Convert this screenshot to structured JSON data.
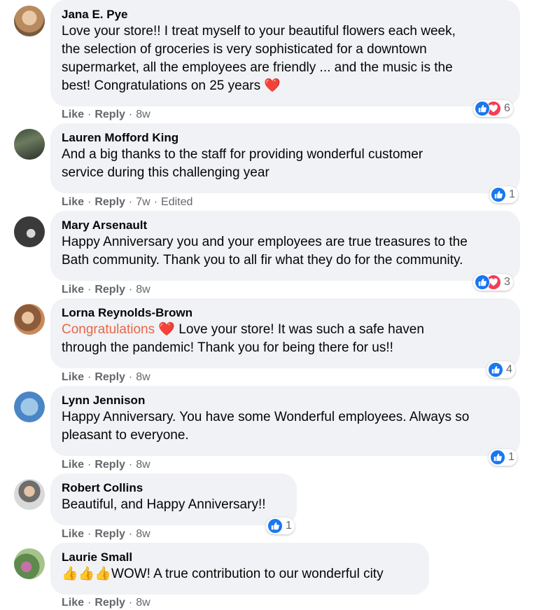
{
  "comments": [
    {
      "name": "Jana E. Pye",
      "lines": [
        "Love your store!! I treat myself to your beautiful flowers each week,",
        "the selection of groceries is very sophisticated for a downtown",
        "supermarket, all the employees are friendly ... and the music is the",
        "best! Congratulations on 25 years ❤️"
      ],
      "like": "Like",
      "reply": "Reply",
      "time": "8w",
      "edited": "",
      "reaction_count": "6",
      "reactions": [
        "like-icon",
        "love-icon"
      ]
    },
    {
      "name": "Lauren Mofford King",
      "lines": [
        "And a big thanks to the staff for providing wonderful customer",
        "service during this challenging year"
      ],
      "like": "Like",
      "reply": "Reply",
      "time": "7w",
      "edited": "Edited",
      "reaction_count": "1",
      "reactions": [
        "like-icon"
      ]
    },
    {
      "name": "Mary Arsenault",
      "lines": [
        "Happy Anniversary you and your employees are true treasures to the",
        "Bath community. Thank you to all fir what they do for the community."
      ],
      "like": "Like",
      "reply": "Reply",
      "time": "8w",
      "edited": "",
      "reaction_count": "3",
      "reactions": [
        "like-icon",
        "love-icon"
      ]
    },
    {
      "name": "Lorna Reynolds-Brown",
      "highlight": "Congratulations",
      "lines": [
        " ❤️ Love your store! It was such a safe haven",
        "through the pandemic! Thank you for being there for us!!"
      ],
      "like": "Like",
      "reply": "Reply",
      "time": "8w",
      "edited": "",
      "reaction_count": "4",
      "reactions": [
        "like-icon"
      ]
    },
    {
      "name": "Lynn Jennison",
      "lines": [
        "Happy Anniversary. You have some Wonderful employees. Always so",
        "pleasant to everyone."
      ],
      "like": "Like",
      "reply": "Reply",
      "time": "8w",
      "edited": "",
      "reaction_count": "1",
      "reactions": [
        "like-icon"
      ]
    },
    {
      "name": "Robert Collins",
      "lines": [
        "Beautiful, and Happy Anniversary!!"
      ],
      "like": "Like",
      "reply": "Reply",
      "time": "8w",
      "edited": "",
      "reaction_count": "1",
      "reactions": [
        "like-icon"
      ]
    },
    {
      "name": "Laurie Small",
      "lines": [
        "👍👍👍WOW! A true contribution to our wonderful city"
      ],
      "like": "Like",
      "reply": "Reply",
      "time": "8w",
      "edited": "",
      "reaction_count": "",
      "reactions": []
    }
  ],
  "colors": {
    "like": "#1877f2",
    "love": "#f33e58",
    "bubble": "#f0f2f5",
    "meta": "#65676b",
    "highlight": "#e8664a"
  },
  "separator": "·"
}
